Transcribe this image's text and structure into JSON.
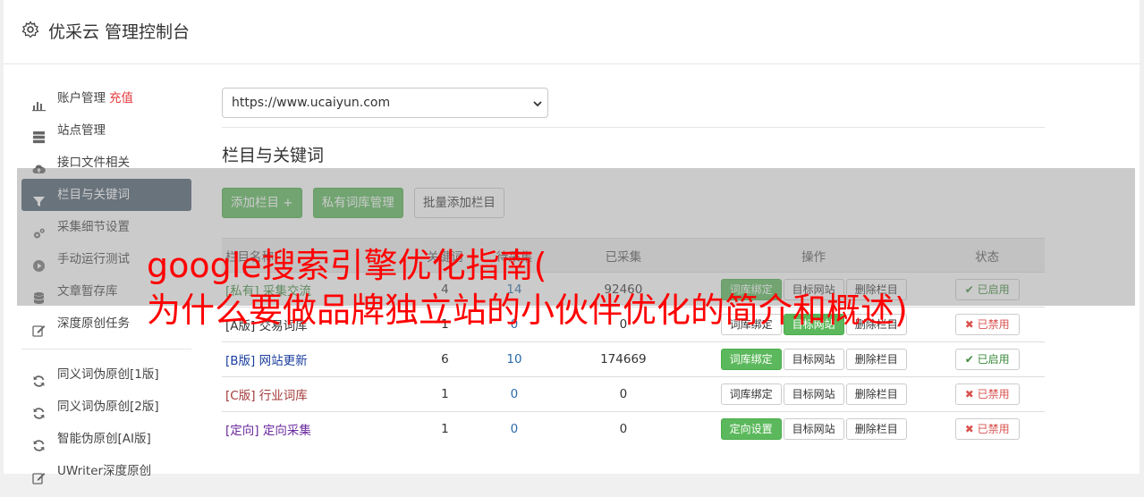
{
  "header": {
    "title": "优采云 管理控制台"
  },
  "sidebar": {
    "items": [
      {
        "label": "账户管理",
        "extra": "充值",
        "icon": "bar-chart-icon"
      },
      {
        "label": "站点管理",
        "icon": "server-icon"
      },
      {
        "label": "接口文件相关",
        "icon": "cloud-upload-icon"
      },
      {
        "label": "栏目与关键词",
        "icon": "filter-icon",
        "active": true
      },
      {
        "label": "采集细节设置",
        "icon": "cogs-icon"
      },
      {
        "label": "手动运行测试",
        "icon": "play-circle-icon"
      },
      {
        "label": "文章暂存库",
        "icon": "database-icon"
      },
      {
        "label": "深度原创任务",
        "icon": "edit-icon"
      }
    ],
    "tools": [
      {
        "label": "同义词伪原创[1版]",
        "icon": "refresh-icon"
      },
      {
        "label": "同义词伪原创[2版]",
        "icon": "refresh-icon"
      },
      {
        "label": "智能伪原创[AI版]",
        "icon": "refresh-icon"
      },
      {
        "label": "UWriter深度原创",
        "icon": "edit-icon"
      }
    ]
  },
  "main": {
    "site_select": {
      "value": "https://www.ucaiyun.com"
    },
    "section_title": "栏目与关键词",
    "buttons": {
      "add": "添加栏目 +",
      "private_lib": "私有词库管理",
      "batch_add": "批量添加栏目"
    },
    "table": {
      "headers": [
        "栏目名称",
        "关键词",
        "待采集",
        "已采集",
        "操作",
        "状态"
      ],
      "rows": [
        {
          "tag": "[私有]",
          "name": "采集交流",
          "tag_class": "tag-private",
          "keywords": "4",
          "pending": "14",
          "collected": "92460",
          "bind": "词库绑定",
          "bind_green": true,
          "target": "目标网站",
          "target_green": false,
          "delete": "删除栏目",
          "status": "已启用",
          "status_on": true
        },
        {
          "tag": "[A版]",
          "name": "交易词库",
          "tag_class": "tag-a",
          "keywords": "1",
          "pending": "0",
          "collected": "0",
          "bind": "词库绑定",
          "bind_green": false,
          "target": "目标网站",
          "target_green": true,
          "delete": "删除栏目",
          "status": "已禁用",
          "status_on": false
        },
        {
          "tag": "[B版]",
          "name": "网站更新",
          "tag_class": "tag-b",
          "keywords": "6",
          "pending": "10",
          "collected": "174669",
          "bind": "词库绑定",
          "bind_green": true,
          "target": "目标网站",
          "target_green": false,
          "delete": "删除栏目",
          "status": "已启用",
          "status_on": true
        },
        {
          "tag": "[C版]",
          "name": "行业词库",
          "tag_class": "tag-c",
          "keywords": "1",
          "pending": "0",
          "collected": "0",
          "bind": "词库绑定",
          "bind_green": false,
          "target": "目标网站",
          "target_green": false,
          "delete": "删除栏目",
          "status": "已禁用",
          "status_on": false
        },
        {
          "tag": "[定向]",
          "name": "定向采集",
          "tag_class": "tag-d",
          "keywords": "1",
          "pending": "0",
          "collected": "0",
          "bind": "定向设置",
          "bind_green": true,
          "target": "目标网站",
          "target_green": false,
          "delete": "删除栏目",
          "status": "已禁用",
          "status_on": false
        }
      ]
    }
  },
  "banner": {
    "line1": "google搜索引擎优化指南(",
    "line2": "为什么要做品牌独立站的小伙伴优化的简介和概述)"
  },
  "colors": {
    "accent_green": "#5cb85c",
    "active_nav": "#4e5f70",
    "banner_text": "#ff0000",
    "danger": "#d9534f"
  }
}
